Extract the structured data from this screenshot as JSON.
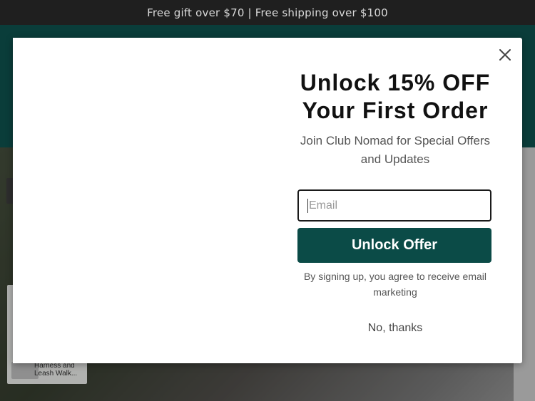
{
  "announcement": {
    "text": "Free gift over $70 | Free shipping over $100"
  },
  "background": {
    "product_card_name": "Harness and Leash Walk..."
  },
  "popup": {
    "headline": "Unlock 15% OFF Your First Order",
    "subhead": "Join Club Nomad for Special Offers and Updates",
    "email_placeholder": "Email",
    "email_value": "",
    "submit_label": "Unlock Offer",
    "disclaimer": "By signing up, you agree to receive email marketing",
    "decline_label": "No, thanks",
    "close_icon": "close-icon"
  },
  "colors": {
    "header_bg": "#0a3d3a",
    "announcement_bg": "#1f1f1f",
    "button_bg": "#0b4b47",
    "button_text": "#ffffff"
  }
}
